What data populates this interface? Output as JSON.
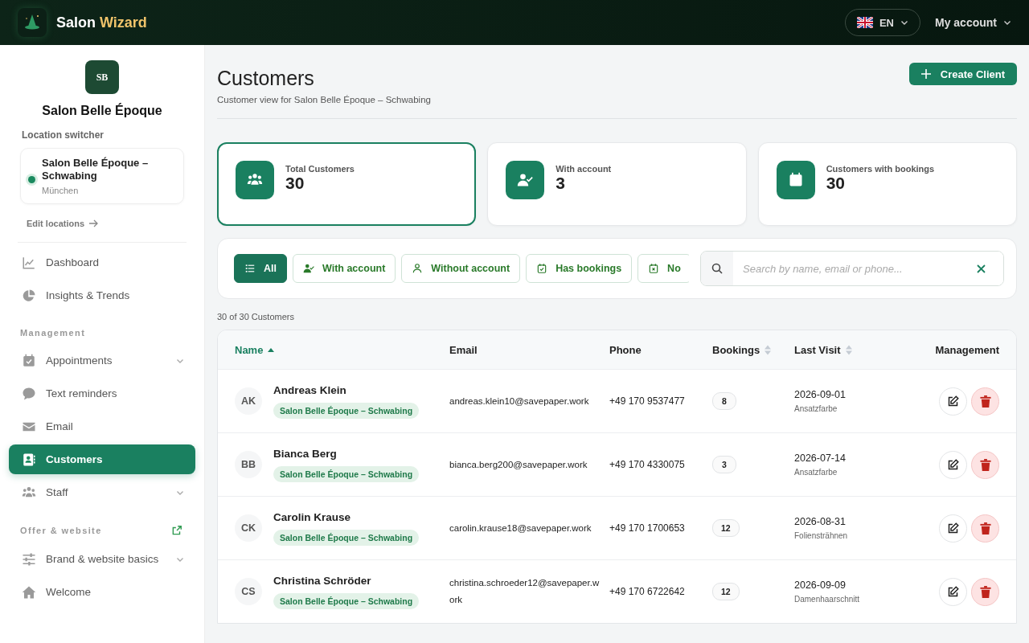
{
  "header": {
    "brand": "Salon",
    "brand_accent": "Wizard",
    "language": "EN",
    "account": "My account"
  },
  "sidebar": {
    "logo": "SB",
    "salon_name": "Salon Belle Époque",
    "switcher_label": "Location switcher",
    "location": {
      "name": "Salon Belle Époque – Schwabing",
      "city": "München",
      "selected": true
    },
    "edit_link": "Edit locations",
    "sections": [
      {
        "items": [
          {
            "kind": "chart",
            "label": "Dashboard",
            "expandable": false,
            "selected": false
          },
          {
            "kind": "pie",
            "label": "Insights & Trends",
            "expandable": false,
            "selected": false
          }
        ]
      },
      {
        "heading": "Management",
        "external": false,
        "items": [
          {
            "kind": "calendar",
            "label": "Appointments",
            "expandable": true,
            "selected": false
          },
          {
            "kind": "sms",
            "label": "Text reminders",
            "expandable": false,
            "selected": false
          },
          {
            "kind": "mail",
            "label": "Email",
            "expandable": false,
            "selected": false
          },
          {
            "kind": "contact",
            "label": "Customers",
            "expandable": false,
            "selected": true
          },
          {
            "kind": "group",
            "label": "Staff",
            "expandable": true,
            "selected": false
          }
        ]
      },
      {
        "heading": "Offer & website",
        "external": true,
        "items": [
          {
            "kind": "sliders",
            "label": "Brand & website basics",
            "expandable": true,
            "selected": false
          },
          {
            "kind": "home",
            "label": "Welcome",
            "expandable": false,
            "selected": false
          }
        ]
      }
    ]
  },
  "page": {
    "title": "Customers",
    "subtitle": "Customer view for Salon Belle Époque – Schwabing",
    "create_button": "Create Client"
  },
  "stats": [
    {
      "kind": "group",
      "label": "Total Customers",
      "value": "30",
      "selected": true
    },
    {
      "kind": "account",
      "label": "With account",
      "value": "3",
      "selected": false
    },
    {
      "kind": "calendar",
      "label": "Customers with bookings",
      "value": "30",
      "selected": false
    }
  ],
  "filters": [
    {
      "kind": "list",
      "label": "All",
      "selected": true
    },
    {
      "kind": "account",
      "label": "With account",
      "selected": false
    },
    {
      "kind": "user",
      "label": "Without account",
      "selected": false
    },
    {
      "kind": "bookings",
      "label": "Has bookings",
      "selected": false
    },
    {
      "kind": "nobookings",
      "label": "No",
      "selected": false
    }
  ],
  "search": {
    "placeholder": "Search by name, email or phone..."
  },
  "count": "30 of 30 Customers",
  "table": {
    "columns": [
      {
        "label": "Name",
        "kind": "sorted"
      },
      {
        "label": "Email",
        "kind": "plain"
      },
      {
        "label": "Phone",
        "kind": "plain"
      },
      {
        "label": "Bookings",
        "kind": "sortable"
      },
      {
        "label": "Last Visit",
        "kind": "sortable"
      },
      {
        "label": "Management",
        "kind": "plain"
      }
    ],
    "rows": [
      {
        "initials": "AK",
        "name": "Andreas Klein",
        "location": "Salon Belle Époque – Schwabing",
        "email": "andreas.klein10@savepaper.work",
        "phone": "+49 170 9537477",
        "bookings": "8",
        "last_visit": "2026-09-01",
        "service": "Ansatzfarbe"
      },
      {
        "initials": "BB",
        "name": "Bianca Berg",
        "location": "Salon Belle Époque – Schwabing",
        "email": "bianca.berg200@savepaper.work",
        "phone": "+49 170 4330075",
        "bookings": "3",
        "last_visit": "2026-07-14",
        "service": "Ansatzfarbe"
      },
      {
        "initials": "CK",
        "name": "Carolin Krause",
        "location": "Salon Belle Époque – Schwabing",
        "email": "carolin.krause18@savepaper.work",
        "phone": "+49 170 1700653",
        "bookings": "12",
        "last_visit": "2026-08-31",
        "service": "Foliensträhnen"
      },
      {
        "initials": "CS",
        "name": "Christina Schröder",
        "location": "Salon Belle Époque – Schwabing",
        "email": "christina.schroeder12@savepaper.work",
        "phone": "+49 170 6722642",
        "bookings": "12",
        "last_visit": "2026-09-09",
        "service": "Damenhaarschnitt"
      }
    ]
  }
}
